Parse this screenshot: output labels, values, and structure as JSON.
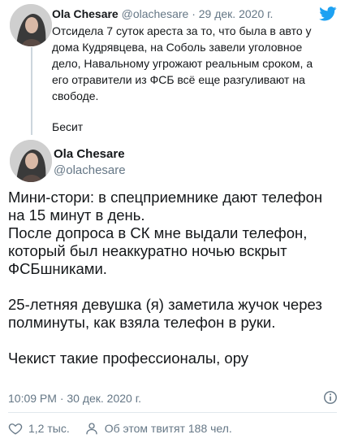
{
  "reply_tweet": {
    "author_name": "Ola Chesare",
    "author_handle": "@olachesare",
    "separator": "·",
    "date": "29 дек. 2020 г.",
    "paragraph1": "Отсидела 7 суток ареста за то, что была в авто у дома Кудрявцева, на Соболь завели уголовное дело, Навальному угрожают реальным сроком, а его отравители из ФСБ всё еще разгуливают на свободе.",
    "paragraph2": "Бесит"
  },
  "main_tweet": {
    "author_name": "Ola Chesare",
    "author_handle": "@olachesare",
    "lines_block1": [
      "Мини-стори: в спецприемнике дают телефон",
      "на 15 минут в день.",
      "После допроса в СК мне выдали телефон,",
      "который был неаккуратно ночью вскрыт",
      "ФСБшниками."
    ],
    "lines_block2": [
      "25-летняя девушка (я) заметила жучок через",
      "полминуты, как взяла телефон в руки."
    ],
    "lines_block3": [
      "Чекист такие профессионалы, ору"
    ],
    "timestamp": "10:09 PM · 30 дек. 2020 г.",
    "likes": "1,2 тыс.",
    "discussion": "Об этом твитят 188 чел."
  },
  "icons": {
    "brand": "twitter-bird-icon",
    "info": "info-icon",
    "like": "heart-icon",
    "discussion": "person-icon"
  },
  "colors": {
    "twitter_blue": "#1da1f2",
    "text_primary": "#14171a",
    "text_secondary": "#657786",
    "thread_line": "#ccd6dd",
    "divider": "#e1e8ed"
  }
}
